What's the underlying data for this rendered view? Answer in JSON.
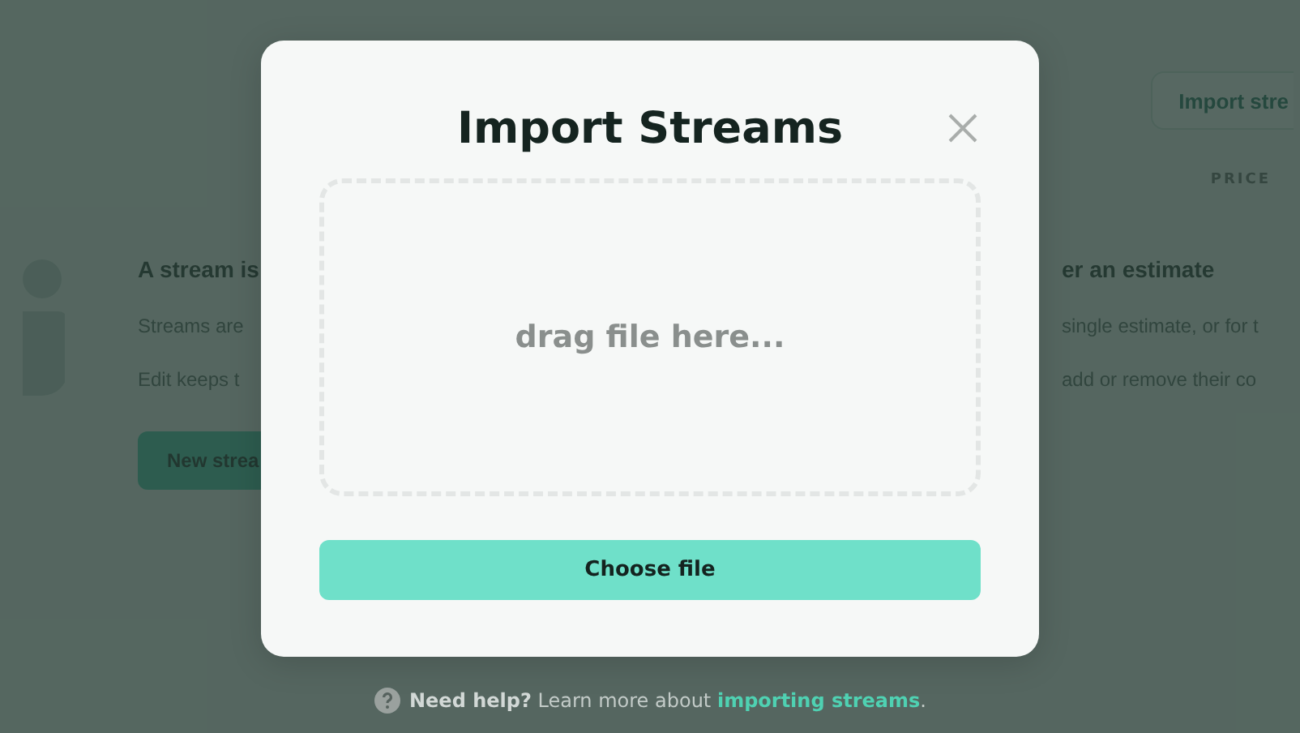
{
  "background": {
    "header_button": "Import stre",
    "column_header": "PRICE",
    "left": {
      "heading": "A stream is",
      "lines": [
        "Streams are",
        "Edit keeps t"
      ],
      "button": "New strea"
    },
    "right": {
      "heading": "er an estimate",
      "lines": [
        "single estimate, or for t",
        "add or remove their co"
      ]
    }
  },
  "dialog": {
    "title": "Import Streams",
    "dropzone": "drag file here...",
    "button": "Choose file"
  },
  "help": {
    "text": "**Need help?** Learn more about ",
    "link": "importing streams",
    "end": "."
  }
}
